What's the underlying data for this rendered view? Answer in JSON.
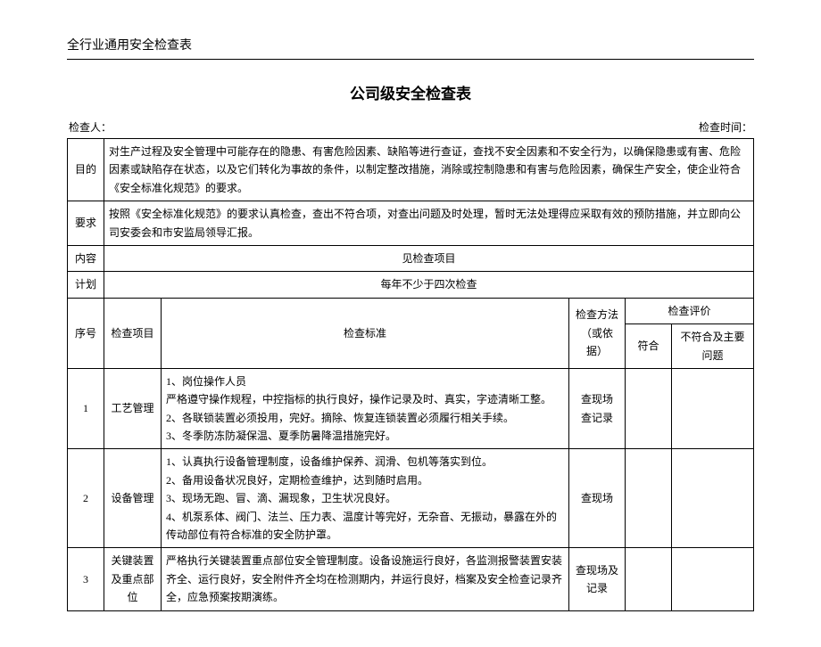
{
  "header": "全行业通用安全检查表",
  "title": "公司级安全检查表",
  "meta": {
    "checker_label": "检查人：",
    "checker_value": "",
    "date_label": "检查时间：",
    "date_value": ""
  },
  "info": {
    "purpose_label": "目的",
    "purpose_text": "对生产过程及安全管理中可能存在的隐患、有害危险因素、缺陷等进行查证，查找不安全因素和不安全行为，以确保隐患或有害、危险因素或缺陷存在状态，以及它们转化为事故的条件，以制定整改措施，消除或控制隐患和有害与危险因素，确保生产安全，使企业符合《安全标准化规范》的要求。",
    "req_label": "要求",
    "req_text": "按照《安全标准化规范》的要求认真检查，查出不符合项，对查出问题及时处理，暂时无法处理得应采取有效的预防措施，并立即向公司安委会和市安监局领导汇报。",
    "content_label": "内容",
    "content_text": "见检查项目",
    "plan_label": "计划",
    "plan_text": "每年不少于四次检查"
  },
  "cols": {
    "seq": "序号",
    "item": "检查项目",
    "std": "检查标准",
    "method": "检查方法（或依据）",
    "eval": "检查评价",
    "eval_ok": "符合",
    "eval_ng": "不符合及主要问题"
  },
  "rows": [
    {
      "seq": "1",
      "item": "工艺管理",
      "std": "1、岗位操作人员\n严格遵守操作规程，中控指标的执行良好，操作记录及时、真实，字迹清晰工整。\n2、各联锁装置必须投用，完好。摘除、恢复连锁装置必须履行相关手续。\n3、冬季防冻防凝保温、夏季防暑降温措施完好。",
      "method": "查现场\n查记录",
      "ok": "",
      "ng": ""
    },
    {
      "seq": "2",
      "item": "设备管理",
      "std": "1、认真执行设备管理制度，设备维护保养、润滑、包机等落实到位。\n2、备用设备状况良好，定期检查维护，达到随时启用。\n3、现场无跑、冒、滴、漏现象，卫生状况良好。\n4、机泵系体、阀门、法兰、压力表、温度计等完好，无杂音、无振动，暴露在外的传动部位有符合标准的安全防护罩。",
      "method": "查现场",
      "ok": "",
      "ng": ""
    },
    {
      "seq": "3",
      "item": "关键装置及重点部位",
      "std": "严格执行关键装置重点部位安全管理制度。设备设施运行良好，各监测报警装置安装齐全、运行良好，安全附件齐全均在检测期内，并运行良好，档案及安全检查记录齐全，应急预案按期演练。",
      "method": "查现场及记录",
      "ok": "",
      "ng": ""
    }
  ]
}
